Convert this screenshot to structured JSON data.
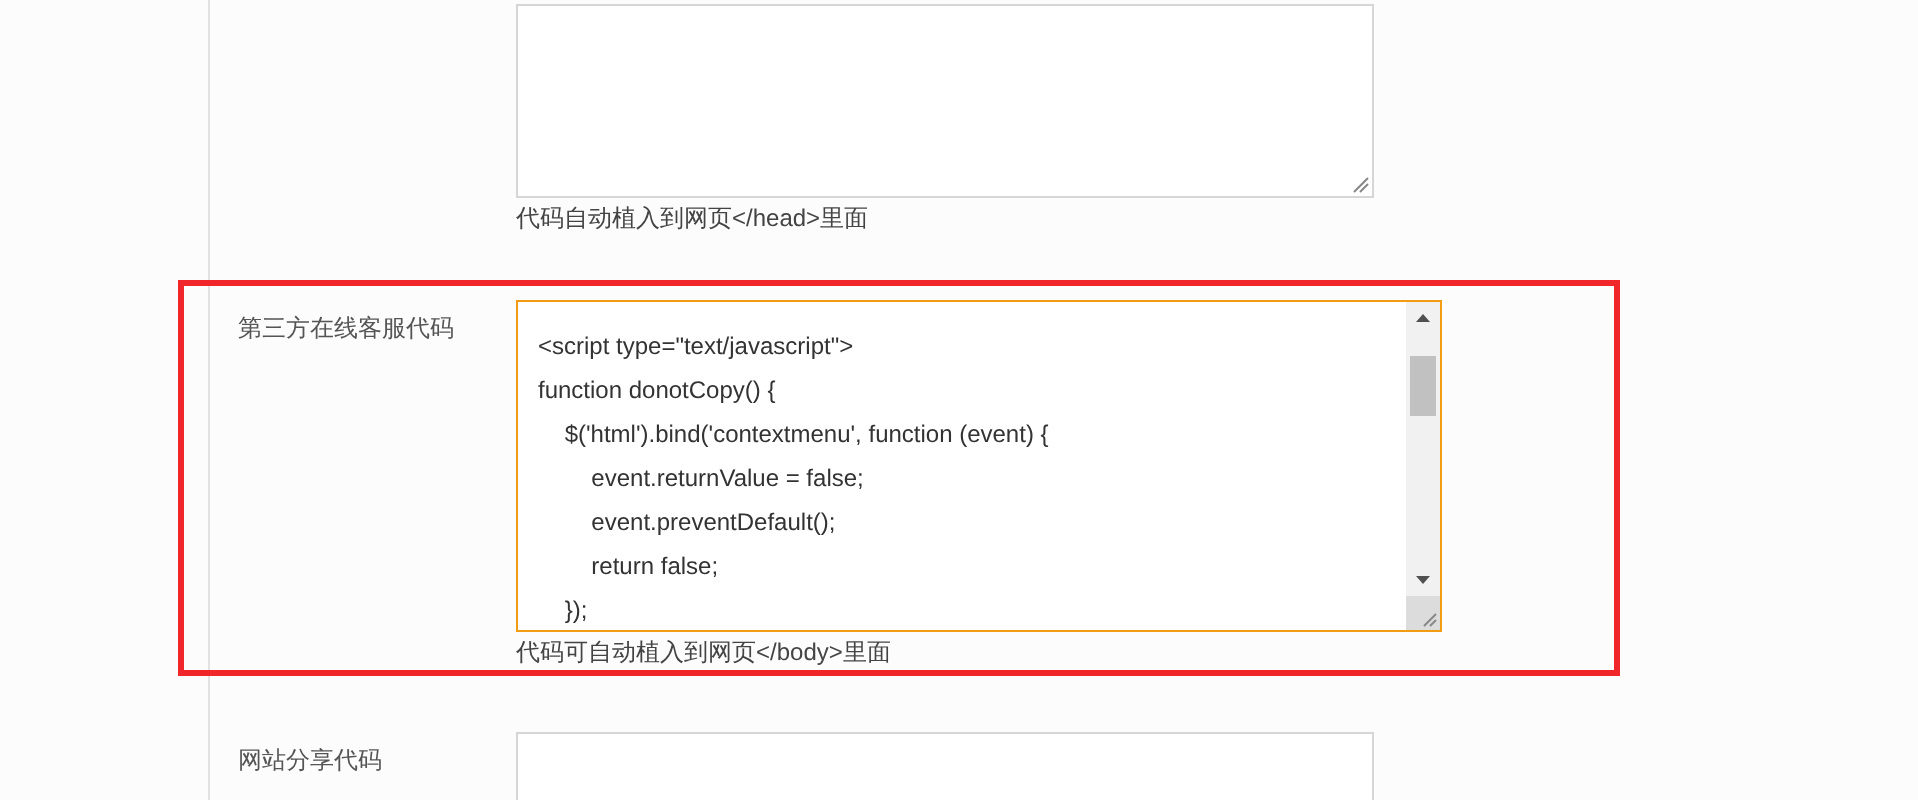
{
  "sections": [
    {
      "highlighted": false,
      "focused": false,
      "hint": "代码自动植入到网页</head>里面"
    },
    {
      "label": "第三方在线客服代码",
      "highlighted": true,
      "focused": true,
      "lines": [
        "<script type=\"text/javascript\">",
        "function donotCopy() {",
        "    $('html').bind('contextmenu', function (event) {",
        "        event.returnValue = false;",
        "        event.preventDefault();",
        "        return false;",
        "    });"
      ],
      "hint": "代码可自动植入到网页</body>里面"
    },
    {
      "label": "网站分享代码",
      "highlighted": false,
      "focused": false
    }
  ]
}
